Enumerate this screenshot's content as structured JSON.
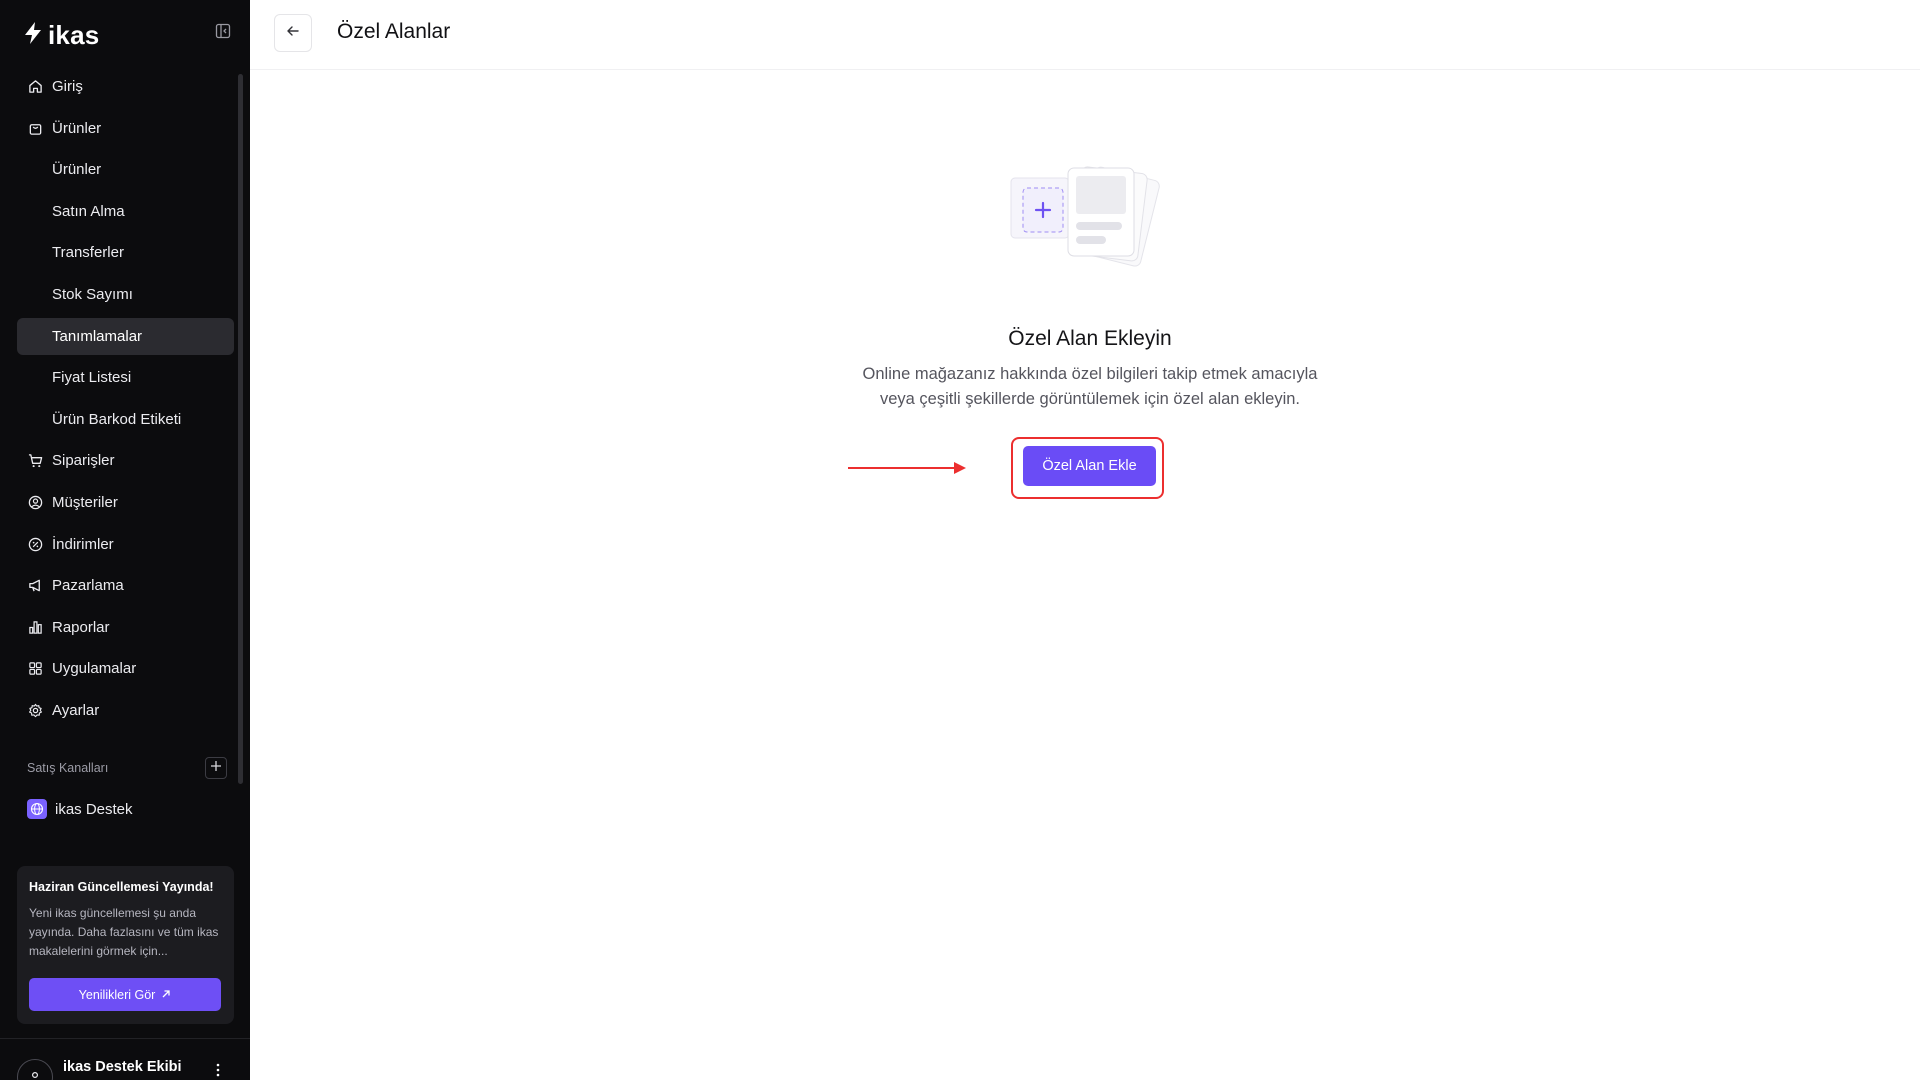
{
  "app": {
    "logo_text": "ikas"
  },
  "sidebar": {
    "items": [
      {
        "label": "Giriş",
        "icon": "home-icon"
      },
      {
        "label": "Ürünler",
        "icon": "bag-icon"
      },
      {
        "label": "Ürünler",
        "sub": true
      },
      {
        "label": "Satın Alma",
        "sub": true
      },
      {
        "label": "Transferler",
        "sub": true
      },
      {
        "label": "Stok Sayımı",
        "sub": true
      },
      {
        "label": "Tanımlamalar",
        "sub": true,
        "active": true
      },
      {
        "label": "Fiyat Listesi",
        "sub": true
      },
      {
        "label": "Ürün Barkod Etiketi",
        "sub": true
      },
      {
        "label": "Siparişler",
        "icon": "cart-icon"
      },
      {
        "label": "Müşteriler",
        "icon": "user-circle-icon"
      },
      {
        "label": "İndirimler",
        "icon": "discount-icon"
      },
      {
        "label": "Pazarlama",
        "icon": "megaphone-icon"
      },
      {
        "label": "Raporlar",
        "icon": "bar-chart-icon"
      },
      {
        "label": "Uygulamalar",
        "icon": "grid-icon"
      },
      {
        "label": "Ayarlar",
        "icon": "gear-icon"
      }
    ],
    "channels_label": "Satış Kanalları",
    "channel_item": "ikas Destek",
    "promo": {
      "title": "Haziran Güncellemesi Yayında!",
      "text": "Yeni ikas güncellemesi şu anda yayında. Daha fazlasını ve tüm ikas makalelerini görmek için...",
      "button": "Yenilikleri Gör"
    },
    "user_name": "ikas Destek Ekibi"
  },
  "header": {
    "title": "Özel Alanlar"
  },
  "empty_state": {
    "title": "Özel Alan Ekleyin",
    "line1": "Online mağazanız hakkında özel bilgileri takip etmek amacıyla",
    "line2": "veya çeşitli şekillerde görüntülemek için özel alan ekleyin.",
    "button": "Özel Alan Ekle"
  },
  "colors": {
    "accent": "#6a4cf6",
    "highlight": "#ec2f2f",
    "sidebar_bg": "#0c0c0e"
  }
}
